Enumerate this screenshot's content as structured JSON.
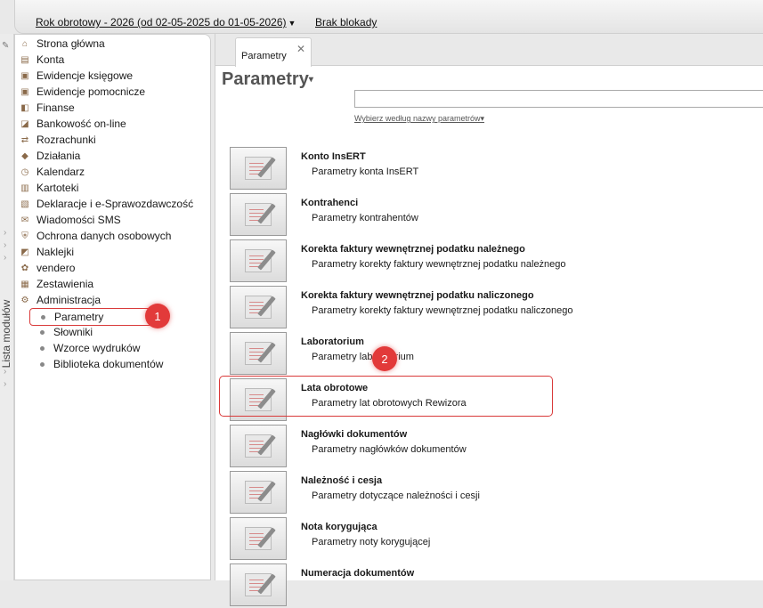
{
  "topbar": {
    "fiscal_year": "Rok obrotowy - 2026  (od 02-05-2025 do 01-05-2026)",
    "caret": "▼",
    "lock_status": "Brak blokady"
  },
  "left_strip": {
    "label": "Lista modułów"
  },
  "sidebar": {
    "items": [
      {
        "label": "Strona główna",
        "icon": "home-icon"
      },
      {
        "label": "Konta",
        "icon": "accounts-icon"
      },
      {
        "label": "Ewidencje księgowe",
        "icon": "ledger-icon"
      },
      {
        "label": "Ewidencje pomocnicze",
        "icon": "aux-ledger-icon"
      },
      {
        "label": "Finanse",
        "icon": "finance-icon"
      },
      {
        "label": "Bankowość on-line",
        "icon": "bank-icon"
      },
      {
        "label": "Rozrachunki",
        "icon": "settlements-icon"
      },
      {
        "label": "Działania",
        "icon": "actions-icon"
      },
      {
        "label": "Kalendarz",
        "icon": "calendar-icon"
      },
      {
        "label": "Kartoteki",
        "icon": "cards-icon"
      },
      {
        "label": "Deklaracje i e-Sprawozdawczość",
        "icon": "declarations-icon"
      },
      {
        "label": "Wiadomości SMS",
        "icon": "sms-icon"
      },
      {
        "label": "Ochrona danych osobowych",
        "icon": "shield-icon"
      },
      {
        "label": "Naklejki",
        "icon": "stickers-icon"
      },
      {
        "label": "vendero",
        "icon": "vendero-icon"
      },
      {
        "label": "Zestawienia",
        "icon": "reports-icon"
      },
      {
        "label": "Administracja",
        "icon": "admin-icon"
      }
    ],
    "sub_items": [
      {
        "label": "Parametry",
        "selected": true
      },
      {
        "label": "Słowniki"
      },
      {
        "label": "Wzorce wydruków"
      },
      {
        "label": "Biblioteka dokumentów"
      }
    ]
  },
  "badges": {
    "one": "1",
    "two": "2"
  },
  "main": {
    "tab_label": "Parametry",
    "tab_close": "✕",
    "title": "Parametry",
    "title_caret": "▾",
    "search_value": "",
    "filter_label": "Wybierz według nazwy parametrów",
    "filter_caret": "▾",
    "rows": [
      {
        "title": "Konto InsERT",
        "desc": "Parametry konta InsERT"
      },
      {
        "title": "Kontrahenci",
        "desc": "Parametry kontrahentów"
      },
      {
        "title": "Korekta faktury wewnętrznej podatku należnego",
        "desc": "Parametry korekty faktury wewnętrznej podatku należnego"
      },
      {
        "title": "Korekta faktury wewnętrznej podatku naliczonego",
        "desc": "Parametry korekty faktury wewnętrznej podatku naliczonego"
      },
      {
        "title": "Laboratorium",
        "desc": "Parametry laboratorium"
      },
      {
        "title": "Lata obrotowe",
        "desc": "Parametry lat obrotowych Rewizora"
      },
      {
        "title": "Nagłówki dokumentów",
        "desc": "Parametry nagłówków dokumentów"
      },
      {
        "title": "Należność i cesja",
        "desc": "Parametry dotyczące należności i cesji"
      },
      {
        "title": "Nota korygująca",
        "desc": "Parametry noty korygującej"
      },
      {
        "title": "Numeracja dokumentów",
        "desc": ""
      }
    ]
  },
  "colors": {
    "accent_red": "#e23a3a",
    "highlight_border": "#d93a3a"
  }
}
